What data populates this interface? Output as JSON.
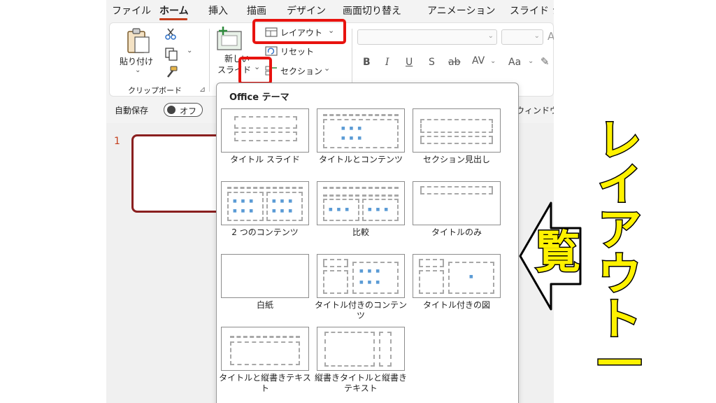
{
  "ribbon_tabs": [
    "ファイル",
    "ホーム",
    "挿入",
    "描画",
    "デザイン",
    "画面切り替え",
    "アニメーション",
    "スライド シ"
  ],
  "clipboard": {
    "paste_label": "貼り付け",
    "group_label": "クリップボード"
  },
  "slides_group": {
    "new_slide_line1": "新しい",
    "new_slide_line2": "スライド",
    "layout_label": "レイアウト",
    "reset_label": "リセット",
    "section_label": "セクション"
  },
  "font_group": {
    "bold": "B",
    "italic": "I",
    "underline": "U",
    "shadow": "S",
    "strike": "ab",
    "spacing": "AV",
    "case": "Aa"
  },
  "autosave": {
    "label": "自動保存",
    "state": "オフ"
  },
  "window_label": "ウィンドウ",
  "slide_number": "1",
  "layout_gallery": {
    "header": "Office テーマ",
    "layouts": [
      "タイトル スライド",
      "タイトルとコンテンツ",
      "セクション見出し",
      "2 つのコンテンツ",
      "比較",
      "タイトルのみ",
      "白紙",
      "タイトル付きのコンテンツ",
      "タイトル付きの図",
      "タイトルと縦書きテキスト",
      "縦書きタイトルと縦書きテキスト"
    ]
  },
  "annotation": {
    "text": "レイアウト一覧",
    "color": "#fff200",
    "highlight_color": "#e8130f"
  },
  "colors": {
    "accent": "#c43e1c",
    "thumb_border": "#8a1f1f"
  }
}
